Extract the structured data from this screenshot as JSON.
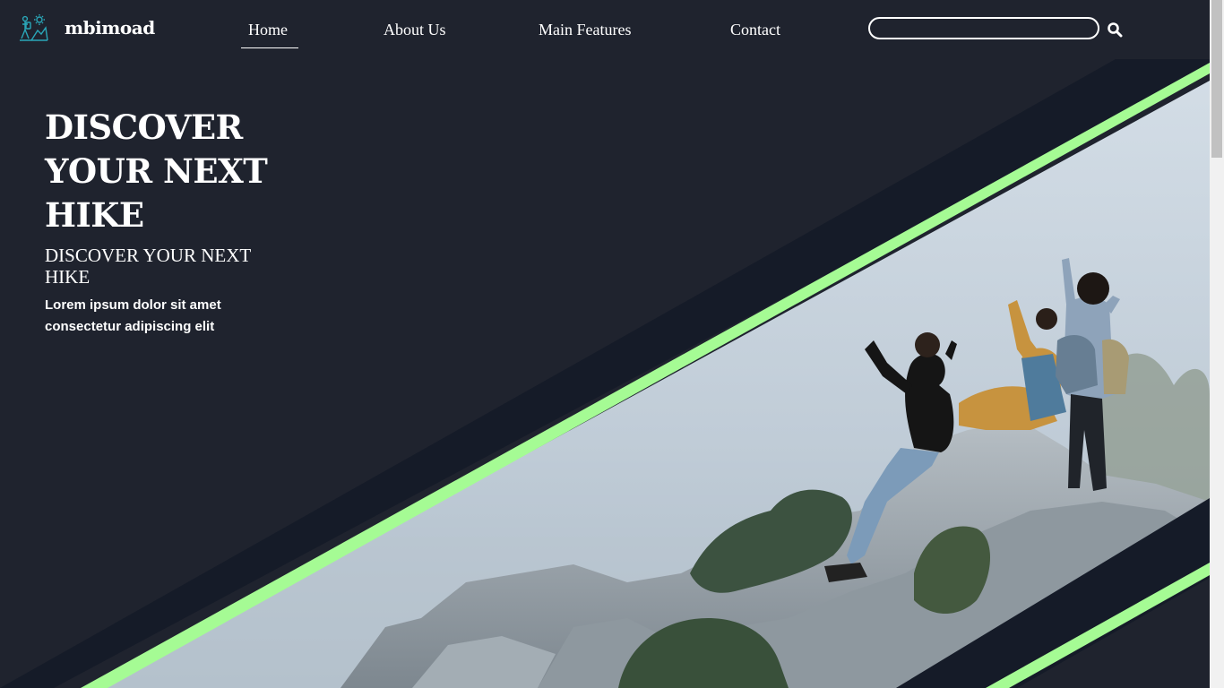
{
  "brand": {
    "name": "mbimoad",
    "logo_icon": "hikers-logo-icon",
    "logo_color": "#2aa7b8"
  },
  "nav": {
    "home": "Home",
    "about": "About Us",
    "features": "Main Features",
    "contact": "Contact",
    "active": "Home"
  },
  "search": {
    "placeholder": "",
    "value": "",
    "icon": "search-icon"
  },
  "hero": {
    "title": "DISCOVER YOUR NEXT HIKE",
    "subtitle": "DISCOVER YOUR NEXT HIKE",
    "description": "Lorem ipsum dolor sit amet consectetur adipiscing elit",
    "image": "group-of-hikers-cheering-on-rocky-summit"
  },
  "colors": {
    "background": "#1f232e",
    "band": "#151b28",
    "accent": "#a5fb94",
    "sky": "#c9d6e0",
    "text": "#ffffff"
  }
}
